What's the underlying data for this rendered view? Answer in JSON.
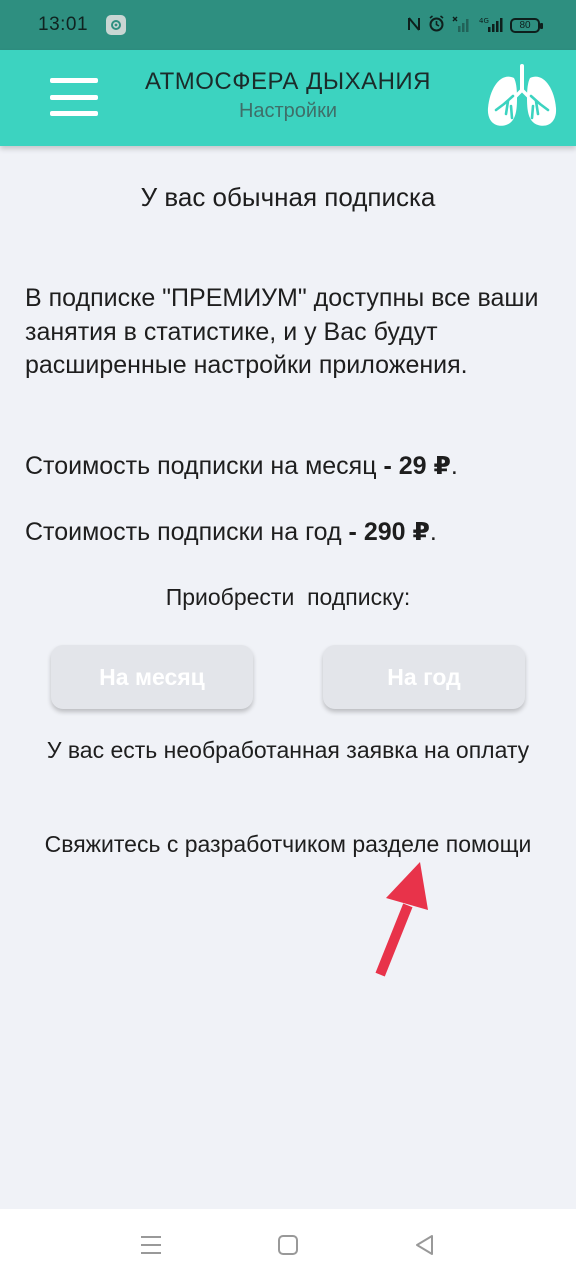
{
  "status_bar": {
    "time": "13:01",
    "battery": "80",
    "icons": [
      "nfc-icon",
      "alarm-icon",
      "signal-icon",
      "network-4g-icon",
      "battery-icon"
    ]
  },
  "app_bar": {
    "title": "АТМОСФЕРА ДЫХАНИЯ",
    "subtitle": "Настройки",
    "background": "#3cd3c0"
  },
  "subscription": {
    "status": "У вас обычная подписка",
    "premium_description": "В подписке \"ПРЕМИУМ\" доступны все ваши занятия в статистике, и у Вас будут расширенные настройки приложения.",
    "price_month_label": "Стоимость подписки на месяц",
    "price_month_value": " - 29 ₽",
    "price_year_label": "Стоимость подписки на год",
    "price_year_value": " - 290 ₽",
    "buy_label": "Приобрести  подписку:",
    "button_month": "На месяц",
    "button_year": "На год",
    "pending_note": "У вас есть необработанная заявка на оплату",
    "contact_note": "Свяжитесь с разработчиком разделе помощи"
  },
  "annotation": {
    "arrow_color": "#e8334a"
  },
  "nav_bar": {
    "icons": [
      "recents-icon",
      "home-icon",
      "back-icon"
    ]
  }
}
